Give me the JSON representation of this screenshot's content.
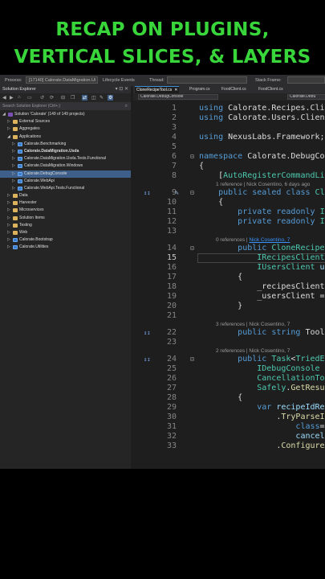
{
  "caption": {
    "line1": "RECAP ON PLUGINS,",
    "line2": "VERTICAL SLICES, & LAYERS"
  },
  "topbar": {
    "process_label": "Process:",
    "process_value": "[17140] Calorate.DataMigration.Ui",
    "lifecycle": "Lifecycle Events",
    "thread": "Thread:",
    "stack": "Stack Frame:"
  },
  "solution_explorer": {
    "title": "Solution Explorer",
    "controls": "▾ ⊡ ✕",
    "search_placeholder": "Search Solution Explorer (Ctrl+;)",
    "items": [
      {
        "label": "Solution 'Calorate' (149 of 149 projects)",
        "type": "sln",
        "depth": 0,
        "expanded": true
      },
      {
        "label": "External Sources",
        "type": "folder",
        "depth": 1,
        "expanded": false
      },
      {
        "label": "Aggregates",
        "type": "folder",
        "depth": 1,
        "expanded": false
      },
      {
        "label": "Applications",
        "type": "folder",
        "depth": 1,
        "expanded": true
      },
      {
        "label": "Calorate.Benchmarking",
        "type": "proj",
        "depth": 2,
        "expanded": false
      },
      {
        "label": "Calorate.DataMigration.Usda",
        "type": "proj",
        "depth": 2,
        "expanded": false,
        "bold": true
      },
      {
        "label": "Calorate.DataMigration.Usda.Tests.Functional",
        "type": "proj",
        "depth": 2,
        "expanded": false
      },
      {
        "label": "Calorate.DataMigration.Windows",
        "type": "proj",
        "depth": 2,
        "expanded": false
      },
      {
        "label": "Calorate.DebugConsole",
        "type": "proj",
        "depth": 2,
        "expanded": false,
        "selected": true
      },
      {
        "label": "Calorate.WebApi",
        "type": "proj",
        "depth": 2,
        "expanded": false
      },
      {
        "label": "Calorate.WebApi.Tests.Functional",
        "type": "proj",
        "depth": 2,
        "expanded": false
      },
      {
        "label": "Data",
        "type": "folder",
        "depth": 1,
        "expanded": false
      },
      {
        "label": "Harvester",
        "type": "folder",
        "depth": 1,
        "expanded": false
      },
      {
        "label": "Microservices",
        "type": "folder",
        "depth": 1,
        "expanded": false
      },
      {
        "label": "Solution Items",
        "type": "folder",
        "depth": 1,
        "expanded": false
      },
      {
        "label": "Testing",
        "type": "folder",
        "depth": 1,
        "expanded": false
      },
      {
        "label": "Web",
        "type": "folder",
        "depth": 1,
        "expanded": false
      },
      {
        "label": "Calorate.Bootstrap",
        "type": "proj",
        "depth": 1,
        "expanded": false
      },
      {
        "label": "Calorate.Utilities",
        "type": "proj",
        "depth": 1,
        "expanded": false
      }
    ]
  },
  "editor": {
    "tabs": [
      {
        "label": "CloneRecipeTool.cs",
        "active": true,
        "close": "✕"
      },
      {
        "label": "Program.cs"
      },
      {
        "label": "FoodClient.cs"
      },
      {
        "label": "FoodClient.cs"
      }
    ],
    "nav_project": "Calorate.DebugConsole",
    "nav_type": "Calorate.Debu",
    "lines": [
      {
        "n": "1",
        "t": "using Calorate.Recipes.Client;"
      },
      {
        "n": "2",
        "t": "using Calorate.Users.Client;"
      },
      {
        "n": "3",
        "t": ""
      },
      {
        "n": "4",
        "t": "using NexusLabs.Framework;"
      },
      {
        "n": "5",
        "t": ""
      },
      {
        "n": "6",
        "t": "namespace Calorate.DebugConsole"
      },
      {
        "n": "7",
        "t": "{"
      },
      {
        "n": "8",
        "t": "    [AutoRegisterCommandLineTool]"
      },
      {
        "n": "9",
        "t": "    public sealed class CloneRecipeTool"
      },
      {
        "n": "10",
        "t": "    {"
      },
      {
        "n": "11",
        "t": "        private readonly IRecipesClient"
      },
      {
        "n": "12",
        "t": "        private readonly IUsersClient"
      },
      {
        "n": "13",
        "t": ""
      },
      {
        "n": "14",
        "t": "        public CloneRecipeTool("
      },
      {
        "n": "15",
        "t": "            IRecipesClient recipesClient"
      },
      {
        "n": "16",
        "t": "            IUsersClient usersClient"
      },
      {
        "n": "17",
        "t": "        {"
      },
      {
        "n": "18",
        "t": "            _recipesClient = recipesClient"
      },
      {
        "n": "19",
        "t": "            _usersClient = usersClient"
      },
      {
        "n": "20",
        "t": "        }"
      },
      {
        "n": "21",
        "t": ""
      },
      {
        "n": "22",
        "t": "        public string ToolName"
      },
      {
        "n": "23",
        "t": ""
      },
      {
        "n": "24",
        "t": "        public Task<TriedEx<"
      },
      {
        "n": "25",
        "t": "            IDebugConsole debug"
      },
      {
        "n": "26",
        "t": "            CancellationToken"
      },
      {
        "n": "27",
        "t": "            Safely.GetResult"
      },
      {
        "n": "28",
        "t": "        {"
      },
      {
        "n": "29",
        "t": "            var recipeIdResult"
      },
      {
        "n": "30",
        "t": "                .TryParseInt"
      },
      {
        "n": "31",
        "t": "                    \"Please e"
      },
      {
        "n": "32",
        "t": "                    cancella"
      },
      {
        "n": "33",
        "t": "                .ConfigureAwa"
      }
    ],
    "lens": [
      {
        "before_line": "9",
        "parts": [
          "1 reference | Nick Cosentino, 6 days ago"
        ]
      },
      {
        "before_line": "14",
        "pre": "0 references | ",
        "link": "Nick Cosentino, 7"
      },
      {
        "before_line": "22",
        "parts": [
          "3 references | Nick Cosentino, 7"
        ]
      },
      {
        "before_line": "24",
        "parts": [
          "2 references | Nick Cosentino, 7"
        ]
      }
    ]
  }
}
